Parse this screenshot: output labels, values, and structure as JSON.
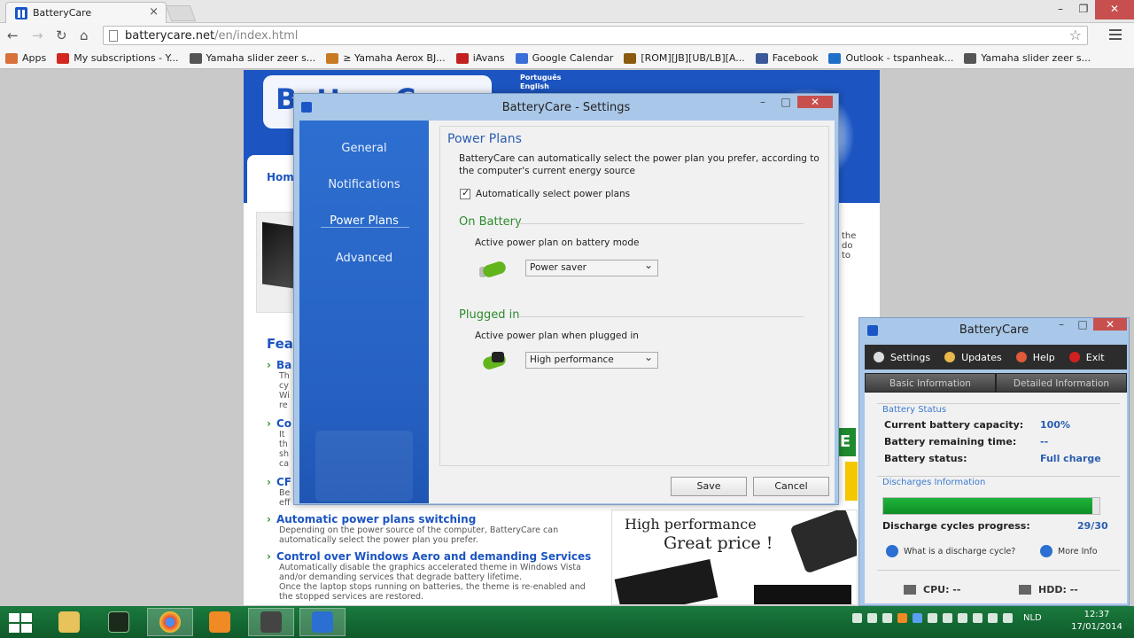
{
  "browser": {
    "tab_title": "BatteryCare",
    "url_host": "batterycare.net",
    "url_path": "/en/index.html",
    "bookmarks": [
      {
        "label": "Apps",
        "color": "#d8703a"
      },
      {
        "label": "My subscriptions - Y...",
        "color": "#d2281e"
      },
      {
        "label": "Yamaha slider zeer s...",
        "color": "#555555"
      },
      {
        "label": "≥ Yamaha Aerox BJ...",
        "color": "#c97a20"
      },
      {
        "label": "iAvans",
        "color": "#c2201e"
      },
      {
        "label": "Google Calendar",
        "color": "#3b6fd8"
      },
      {
        "label": "[ROM][JB][UB/LB][A...",
        "color": "#8a5a10"
      },
      {
        "label": "Facebook",
        "color": "#3b5998"
      },
      {
        "label": "Outlook - tspanheak...",
        "color": "#1f6fc8"
      },
      {
        "label": "Yamaha slider zeer s...",
        "color": "#555555"
      }
    ]
  },
  "website": {
    "logo": "BatteryCare",
    "languages": [
      "Português",
      "English"
    ],
    "home_tab": "Hom",
    "right_text": [
      "the",
      "do",
      "to"
    ],
    "features_heading": "Fea",
    "truncated_features": [
      {
        "title": "Ba",
        "lines": [
          "Th",
          "cy",
          "Wi",
          "re"
        ]
      },
      {
        "title": "Co",
        "lines": [
          "It",
          "th",
          "sh",
          "ca"
        ]
      },
      {
        "title": "CF",
        "lines": [
          "Be",
          "eff"
        ]
      }
    ],
    "features": [
      {
        "title": "Automatic power plans switching",
        "desc": [
          "Depending on the power source of the computer, BatteryCare can",
          "automatically select the power plan you prefer."
        ]
      },
      {
        "title": "Control over Windows Aero and demanding Services",
        "desc": [
          "Automatically disable the graphics accelerated theme in Windows Vista",
          "and/or demanding services that degrade battery lifetime.",
          "Once the laptop stops running on batteries, the theme is re-enabled and",
          "the stopped services are restored."
        ]
      }
    ],
    "ad_line1": "High performance",
    "ad_line2": "Great price !",
    "green_badge": "E"
  },
  "settings_dialog": {
    "title": "BatteryCare - Settings",
    "nav": [
      "General",
      "Notifications",
      "Power Plans",
      "Advanced"
    ],
    "active_nav": "Power Plans",
    "heading": "Power Plans",
    "description": "BatteryCare can automatically select the power plan you prefer, according to the computer's current energy source",
    "auto_select_label": "Automatically select power plans",
    "auto_select_checked": true,
    "on_battery": {
      "title": "On Battery",
      "subtitle": "Active power plan on battery mode",
      "selected": "Power saver"
    },
    "plugged_in": {
      "title": "Plugged in",
      "subtitle": "Active power plan when plugged in",
      "selected": "High performance"
    },
    "save_label": "Save",
    "cancel_label": "Cancel"
  },
  "mini_window": {
    "title": "BatteryCare",
    "menu": [
      {
        "label": "Settings",
        "icon": "gear-icon",
        "color": "#dddddd"
      },
      {
        "label": "Updates",
        "icon": "updates-icon",
        "color": "#e8b84a"
      },
      {
        "label": "Help",
        "icon": "help-icon",
        "color": "#e05a3a"
      },
      {
        "label": "Exit",
        "icon": "exit-icon",
        "color": "#d22020"
      }
    ],
    "tabs": [
      "Basic Information",
      "Detailed Information"
    ],
    "battery_status_label": "Battery Status",
    "rows": [
      {
        "label": "Current battery capacity:",
        "value": "100%"
      },
      {
        "label": "Battery remaining time:",
        "value": "--"
      },
      {
        "label": "Battery status:",
        "value": "Full charge"
      }
    ],
    "discharges_label": "Discharges Information",
    "discharge_progress_fraction": 0.967,
    "discharge_cycles_label": "Discharge cycles progress:",
    "discharge_cycles_value": "29/30",
    "what_is_link": "What is a discharge cycle?",
    "more_info_link": "More Info",
    "cpu_label": "CPU: --",
    "hdd_label": "HDD: --"
  },
  "taskbar": {
    "language": "NLD",
    "time": "12:37",
    "date": "17/01/2014"
  }
}
